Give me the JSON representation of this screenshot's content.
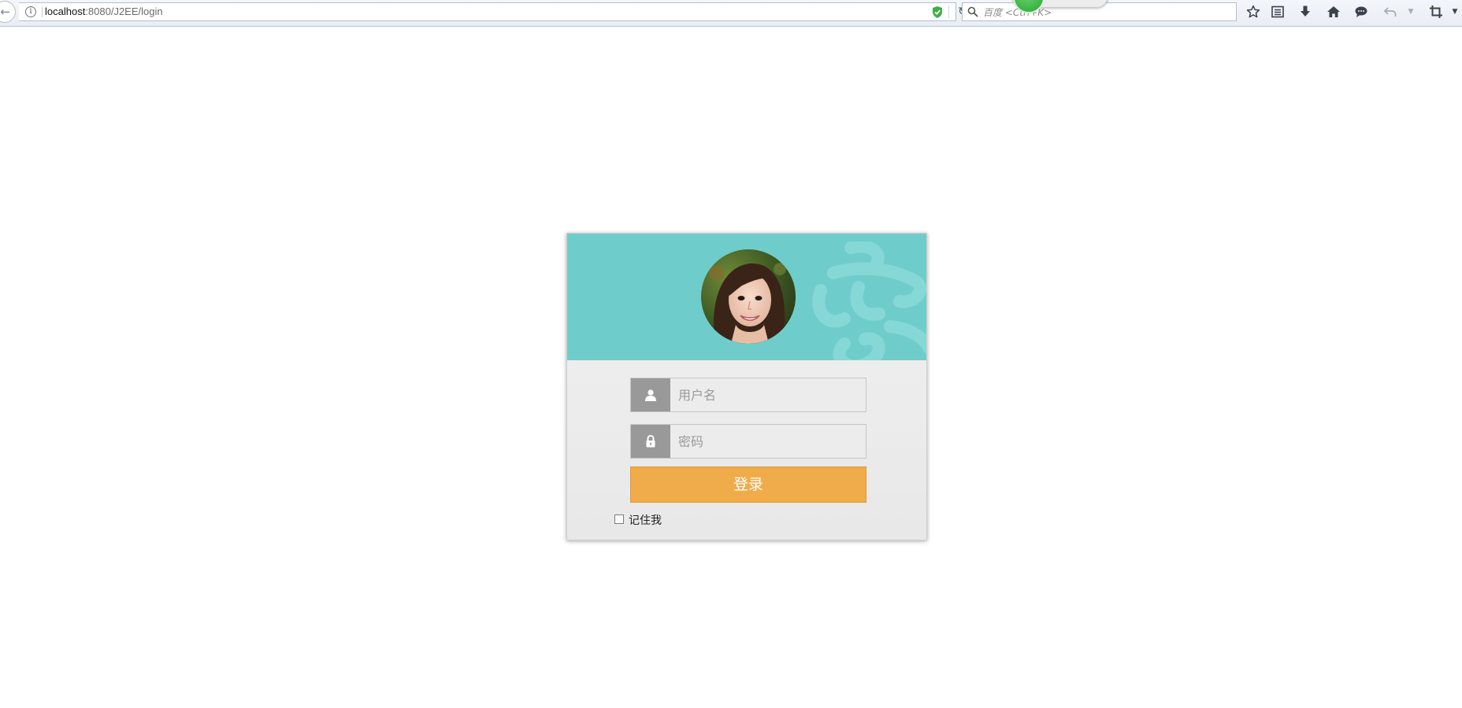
{
  "browser": {
    "url_host": "localhost",
    "url_rest": ":8080/J2EE/login",
    "search_placeholder": "百度 <Ctrl+K>",
    "floating_widget_text": "..."
  },
  "login": {
    "username_placeholder": "用户名",
    "password_placeholder": "密码",
    "submit_label": "登录",
    "remember_label": "记住我"
  },
  "colors": {
    "header": "#6ecdcb",
    "button": "#f0ab4a",
    "icon_box": "#999999"
  },
  "icons": {
    "back": "arrow-left-icon",
    "info": "info-icon",
    "shield": "shield-check-icon",
    "reload": "reload-icon",
    "search": "search-icon",
    "bookmark": "star-icon",
    "reading_list": "reading-list-icon",
    "download": "download-icon",
    "home": "home-icon",
    "chat": "chat-icon",
    "undo": "undo-icon",
    "crop": "crop-icon",
    "user": "user-icon",
    "lock": "lock-icon"
  }
}
